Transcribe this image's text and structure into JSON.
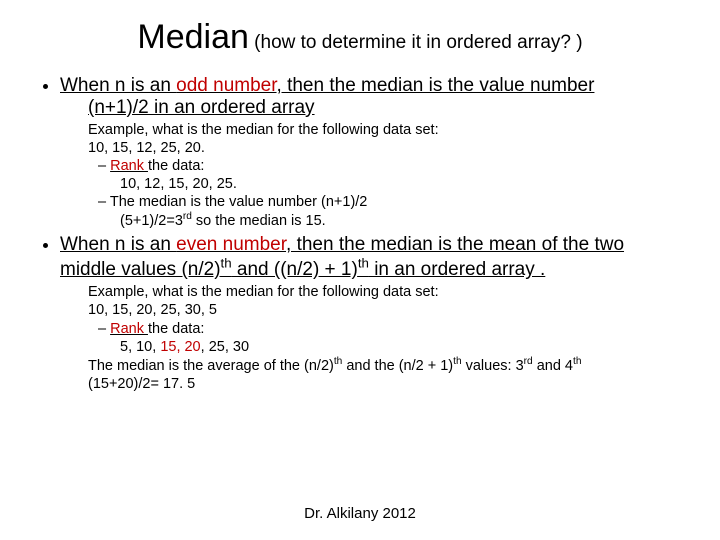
{
  "title": {
    "main": "Median",
    "sub": " (how to determine it in ordered array? )"
  },
  "odd": {
    "lead": "When n is an ",
    "kind": "odd number",
    "tail": ", then the median is the value number",
    "formula": "(n+1)/2 in an ordered array",
    "ex_intro": "Example, what is the median for the following data set:",
    "ex_data": "10, 15, 12, 25, 20.",
    "rank_label": "Rank ",
    "rank_tail": "the data:",
    "ex_ranked": "10, 12, 15, 20, 25.",
    "median_rule": "The median is the value number (n+1)/2",
    "median_calc_a": "(5+1)/2=3",
    "median_calc_b": " so the median is 15."
  },
  "even": {
    "lead": "When n is an ",
    "kind": "even number",
    "mid1": ", then the median is the mean of the two middle values (n/2)",
    "mid2": " and ((n/2) + 1)",
    "tail": " in an ordered array .",
    "ex_intro": "Example, what is the median for the following data set:",
    "ex_data": "10, 15, 20, 25, 30, 5",
    "rank_label": "Rank ",
    "rank_tail": "the data:",
    "ex_ranked_a": "5, 10, ",
    "ex_ranked_b": "15, 20",
    "ex_ranked_c": ", 25, 30",
    "median_rule_a": "The median is the average of the (n/2)",
    "median_rule_b": " and the (n/2 + 1)",
    "median_rule_c": " values: 3",
    "median_rule_d": " and 4",
    "median_calc": "(15+20)/2= 17. 5"
  },
  "sup": {
    "th": "th",
    "rd": "rd"
  },
  "footer": "Dr. Alkilany 2012"
}
